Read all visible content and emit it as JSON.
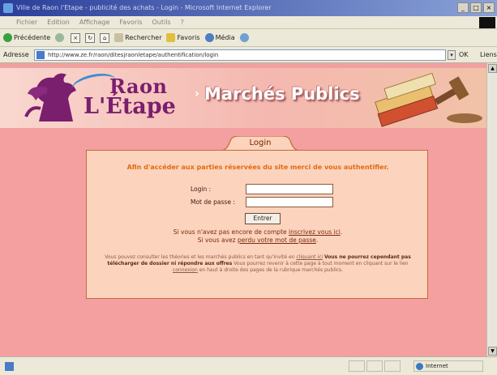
{
  "window": {
    "title": "Ville de Raon l'Etape - publicité des achats - Login - Microsoft Internet Explorer",
    "controls": [
      "_",
      "□",
      "×"
    ]
  },
  "menu": [
    "Fichier",
    "Edition",
    "Affichage",
    "Favoris",
    "Outils",
    "?"
  ],
  "toolbar": {
    "back": "Précédente",
    "search": "Rechercher",
    "favorites": "Favoris",
    "media": "Média"
  },
  "address": {
    "label": "Adresse",
    "url": "http://www.ze.fr/raon/ditesjraonletape/authentification/login",
    "go": "OK",
    "links": "Liens"
  },
  "banner": {
    "logo_line1": "Raon",
    "logo_line2": "L'Étape",
    "section_title": "Marchés Publics",
    "colors": {
      "logo": "#7a1e6e",
      "accent": "#3a8fd0"
    }
  },
  "login": {
    "tab_label": "Login",
    "intro": "Afin d'accéder aux parties réservées du site merci de vous authentifier.",
    "login_label": "Login :",
    "password_label": "Mot de passe :",
    "login_value": "",
    "password_value": "",
    "submit_label": "Entrer",
    "no_account_prefix": "Si vous n'avez pas encore de compte",
    "no_account_link": "inscrivez vous ici",
    "no_account_suffix": ".",
    "lost_prefix": "Si vous avez",
    "lost_link": "perdu votre mot de passe",
    "lost_suffix": ".",
    "info_part1": "Vous pouvez consulter les théories et les marchés publics en tant qu'invité en",
    "info_link1": "cliquant ici",
    "info_strong": "Vous ne pourrez cependant pas télécharger de dossier ni répondre aux offres",
    "info_part2": "Vous pourrez revenir à cette page à tout moment en cliquant sur le lien",
    "info_link2": "connexion",
    "info_part3": "en haut à droite des pages de la rubrique marchés publics.",
    "colors": {
      "panel": "#fcd3bc",
      "border": "#c46b3a",
      "intro": "#e06a10"
    }
  },
  "status": {
    "zone": "Internet"
  }
}
